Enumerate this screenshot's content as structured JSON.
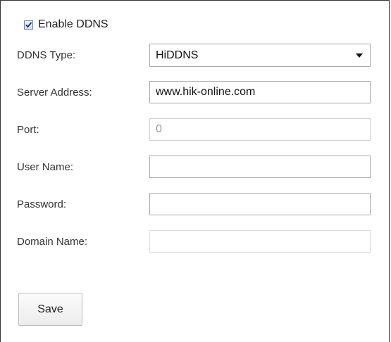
{
  "enable_ddns": {
    "label": "Enable DDNS",
    "checked": true
  },
  "form": {
    "ddns_type": {
      "label": "DDNS Type:",
      "value": "HiDDNS",
      "icon": "chevron-down-icon"
    },
    "server_address": {
      "label": "Server Address:",
      "value": "www.hik-online.com"
    },
    "port": {
      "label": "Port:",
      "value": "0"
    },
    "user_name": {
      "label": "User Name:",
      "value": ""
    },
    "password": {
      "label": "Password:",
      "value": ""
    },
    "domain_name": {
      "label": "Domain Name:",
      "value": ""
    }
  },
  "actions": {
    "save_label": "Save"
  }
}
